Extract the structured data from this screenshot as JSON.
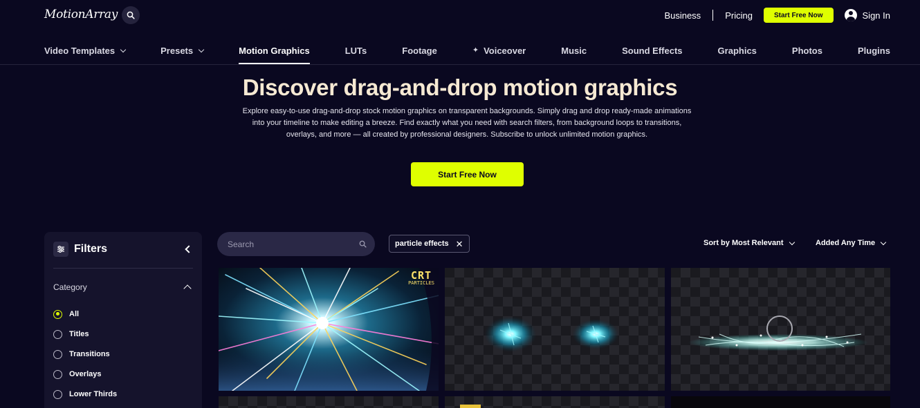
{
  "header": {
    "logo": "MotionArray",
    "links": {
      "business": "Business",
      "pricing": "Pricing"
    },
    "cta": "Start Free Now",
    "signin": "Sign In"
  },
  "nav": {
    "video_templates": "Video Templates",
    "presets": "Presets",
    "motion_graphics": "Motion Graphics",
    "luts": "LUTs",
    "footage": "Footage",
    "voiceover": "Voiceover",
    "music": "Music",
    "sound_effects": "Sound Effects",
    "graphics": "Graphics",
    "photos": "Photos",
    "plugins": "Plugins"
  },
  "hero": {
    "title": "Discover drag-and-drop motion graphics",
    "description": "Explore easy-to-use drag-and-drop stock motion graphics on transparent backgrounds. Simply drag and drop ready-made animations into your timeline to make editing a breeze. Find exactly what you need with search filters, from background loops to transitions, overlays, and more — all created by professional designers. Subscribe to unlock unlimited motion graphics.",
    "cta": "Start Free Now"
  },
  "filters": {
    "title": "Filters",
    "category_label": "Category",
    "options": [
      "All",
      "Titles",
      "Transitions",
      "Overlays",
      "Lower Thirds"
    ],
    "selected": "All"
  },
  "toolbar": {
    "search_placeholder": "Search",
    "active_tag": "particle effects",
    "sort": "Sort by Most Relevant",
    "time": "Added Any Time"
  },
  "results": {
    "card1_badge_big": "CRT",
    "card1_badge_small": "PARTICLES"
  },
  "colors": {
    "background": "#0a0820",
    "accent": "#dfff00",
    "hero_title": "#f6e9d3",
    "panel": "#15132c"
  }
}
